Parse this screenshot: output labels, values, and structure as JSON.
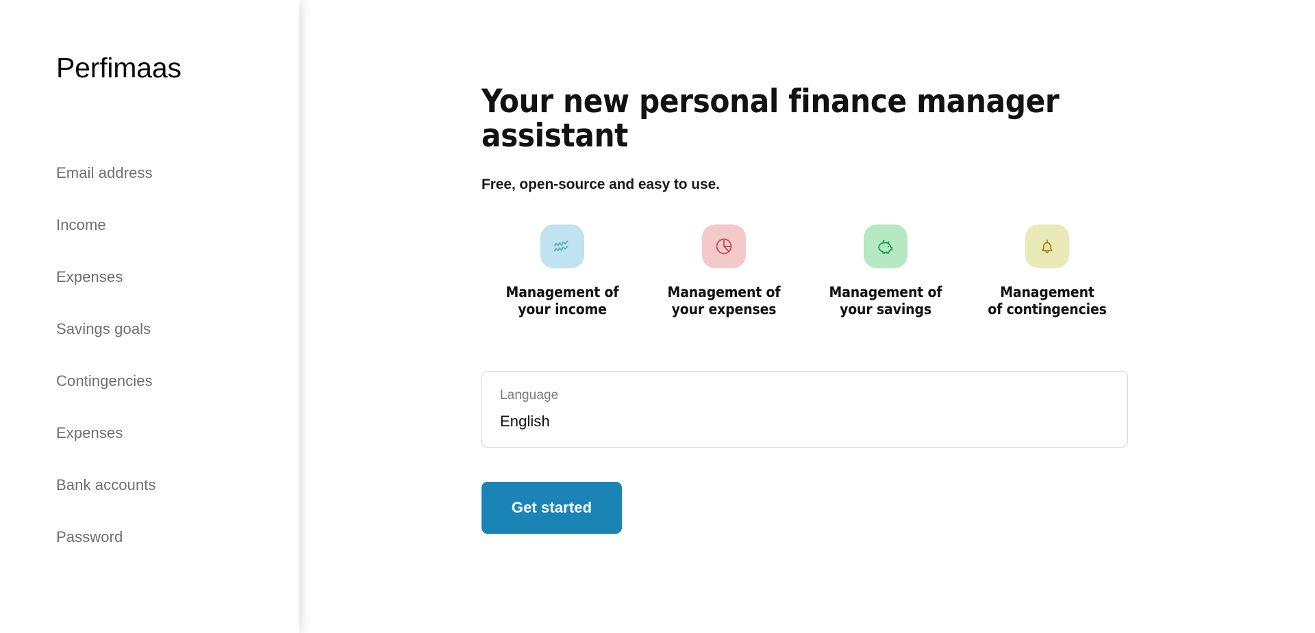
{
  "app": {
    "brand": "Perfimaas",
    "accent_color": "#1a84b6"
  },
  "sidebar": {
    "items": [
      {
        "label": "Email address"
      },
      {
        "label": "Income"
      },
      {
        "label": "Expenses"
      },
      {
        "label": "Savings goals"
      },
      {
        "label": "Contingencies"
      },
      {
        "label": "Expenses"
      },
      {
        "label": "Bank accounts"
      },
      {
        "label": "Password"
      }
    ]
  },
  "main": {
    "headline": "Your new personal finance manager assistant",
    "subhead": "Free, open-source and easy to use.",
    "features": [
      {
        "label": "Management of\nyour income",
        "icon": "activity-wave-icon",
        "badge_color": "#bfe3ef",
        "icon_color": "#63b2cb"
      },
      {
        "label": "Management of\nyour expenses",
        "icon": "pie-chart-icon",
        "badge_color": "#f3c9c9",
        "icon_color": "#c0585c"
      },
      {
        "label": "Management of\nyour savings",
        "icon": "piggy-bank-icon",
        "badge_color": "#b6e8c1",
        "icon_color": "#1fa558"
      },
      {
        "label": "Management\nof contingencies",
        "icon": "bell-icon",
        "badge_color": "#eae9b8",
        "icon_color": "#9a8c13"
      }
    ],
    "language_field": {
      "label": "Language",
      "value": "English"
    },
    "cta_label": "Get started"
  }
}
